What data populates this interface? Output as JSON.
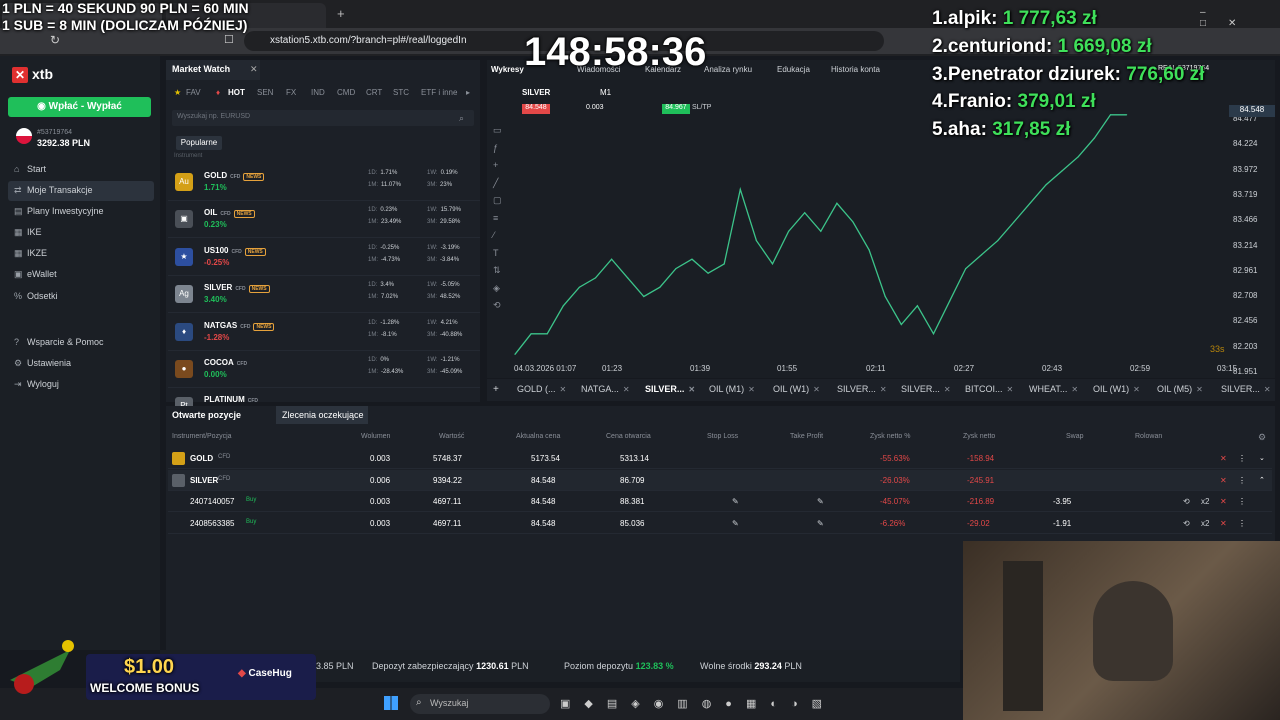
{
  "overlay": {
    "top_line1": "1 PLN =  40 SEKUND 90 PLN = 60 MIN",
    "top_line2": "1 SUB = 8 MIN (DOLICZAM PÓŹNIEJ)",
    "timer": "148:58:36",
    "leaderboard": [
      {
        "rank_name": "1.alpik:",
        "amount": "1 777,63 zł"
      },
      {
        "rank_name": "2.centuriond:",
        "amount": "1 669,08 zł"
      },
      {
        "rank_name": "3.Penetrator dziurek:",
        "amount": "776,60 zł"
      },
      {
        "rank_name": "4.Franio:",
        "amount": "379,01 zł"
      },
      {
        "rank_name": "5.aha:",
        "amount": "317,85 zł"
      }
    ],
    "bonus_amount": "$1.00",
    "bonus_text": "WELCOME BONUS",
    "bonus_brand": "CaseHug",
    "real_badge": "REAL 53719764"
  },
  "browser": {
    "url": "xstation5.xtb.com/?branch=pl#/real/loggedIn"
  },
  "sidebar": {
    "logo": "xtb",
    "deposit_button": "Wpłać - Wypłać",
    "account_number": "#53719764",
    "balance": "3292.38 PLN",
    "items": [
      {
        "label": "Start",
        "icon": "home-icon"
      },
      {
        "label": "Moje Transakcje",
        "icon": "transactions-icon"
      },
      {
        "label": "Plany Inwestycyjne",
        "icon": "plans-icon"
      },
      {
        "label": "IKE",
        "icon": "ike-icon"
      },
      {
        "label": "IKZE",
        "icon": "ikze-icon"
      },
      {
        "label": "eWallet",
        "icon": "wallet-icon"
      },
      {
        "label": "Odsetki",
        "icon": "percent-icon"
      },
      {
        "label": "Wsparcie & Pomoc",
        "icon": "help-icon"
      },
      {
        "label": "Ustawienia",
        "icon": "settings-icon"
      },
      {
        "label": "Wyloguj",
        "icon": "logout-icon"
      }
    ]
  },
  "market_watch": {
    "title": "Market Watch",
    "filters": [
      "FAV",
      "HOT",
      "SEN",
      "FX",
      "IND",
      "CMD",
      "CRT",
      "STC",
      "ETF i inne"
    ],
    "search_placeholder": "Wyszukaj np. EURUSD",
    "popular_button": "Popularne",
    "section_label": "Instrument",
    "cfd_label": "CFD",
    "news_label": "NEWS",
    "instruments": [
      {
        "name": "GOLD",
        "change": "1.71%",
        "icon": "Au",
        "color": "#d4a017",
        "d1": "1.71%",
        "m1": "11.07%",
        "w1": "0.19%",
        "m3": "23%",
        "news": true
      },
      {
        "name": "OIL",
        "change": "0.23%",
        "icon": "▣",
        "color": "#4a4f57",
        "d1": "0.23%",
        "m1": "23.49%",
        "w1": "15.79%",
        "m3": "29.58%",
        "news": true
      },
      {
        "name": "US100",
        "change": "-0.25%",
        "icon": "★",
        "color": "#2d4fa0",
        "d1": "-0.25%",
        "m1": "-4.73%",
        "w1": "-3.19%",
        "m3": "-3.84%",
        "news": true
      },
      {
        "name": "SILVER",
        "change": "3.40%",
        "icon": "Ag",
        "color": "#7d8590",
        "d1": "3.4%",
        "m1": "7.02%",
        "w1": "-5.05%",
        "m3": "48.52%",
        "news": true
      },
      {
        "name": "NATGAS",
        "change": "-1.28%",
        "icon": "♦",
        "color": "#2b4a80",
        "d1": "-1.28%",
        "m1": "-8.1%",
        "w1": "4.21%",
        "m3": "-40.88%",
        "news": true
      },
      {
        "name": "COCOA",
        "change": "0.00%",
        "icon": "●",
        "color": "#7a4a1e",
        "d1": "0%",
        "m1": "-28.43%",
        "w1": "-1.21%",
        "m3": "-45.09%",
        "news": false
      },
      {
        "name": "PLATINUM",
        "change": "",
        "icon": "Pt",
        "color": "#5a6068",
        "d1": "",
        "m1": "",
        "w1": "",
        "m3": "",
        "news": false
      }
    ],
    "stat_labels": {
      "d1": "1D:",
      "m1": "1M:",
      "w1": "1W:",
      "m3": "3M:"
    }
  },
  "chart_panel": {
    "menu": [
      "Wykresy",
      "Wiadomości",
      "Kalendarz",
      "Analiza rynku",
      "Edukacja",
      "Historia konta"
    ],
    "symbol": "SILVER",
    "timeframe": "M1",
    "bid": "84.548",
    "volume": "0.003",
    "ask": "84.967",
    "sltp": "SL/TP",
    "countdown": "33s",
    "y_ticks": [
      "84.477",
      "84.224",
      "83.972",
      "83.719",
      "83.466",
      "83.214",
      "82.961",
      "82.708",
      "82.456",
      "82.203",
      "81.951"
    ],
    "price_marker": "84.548",
    "x_ticks": [
      "04.03.2026 01:07",
      "01:23",
      "01:39",
      "01:55",
      "02:11",
      "02:27",
      "02:43",
      "02:59",
      "03:15"
    ],
    "symbol_tabs": [
      "GOLD (...",
      "NATGA...",
      "SILVER...",
      "OIL (M1)",
      "OIL (W1)",
      "SILVER...",
      "SILVER...",
      "BITCOI...",
      "WHEAT...",
      "OIL (W1)",
      "OIL (M5)",
      "SILVER..."
    ],
    "active_tab_index": 2
  },
  "chart_data": {
    "type": "line",
    "x": [
      "01:07",
      "01:10",
      "01:13",
      "01:16",
      "01:19",
      "01:22",
      "01:25",
      "01:28",
      "01:31",
      "01:34",
      "01:37",
      "01:40",
      "01:43",
      "01:46",
      "01:49",
      "01:52",
      "01:55",
      "01:58",
      "02:01",
      "02:04",
      "02:07",
      "02:10",
      "02:13",
      "02:16",
      "02:19",
      "02:22",
      "02:25",
      "02:28",
      "02:31",
      "02:34",
      "02:37",
      "02:40",
      "02:43",
      "02:46",
      "02:49",
      "02:52",
      "02:55",
      "02:58",
      "03:01"
    ],
    "values": [
      81.98,
      82.2,
      82.2,
      82.5,
      82.7,
      82.8,
      83.0,
      82.8,
      82.6,
      82.7,
      82.9,
      83.0,
      82.85,
      82.95,
      83.75,
      83.2,
      82.95,
      83.3,
      83.5,
      83.3,
      83.6,
      83.4,
      83.1,
      82.6,
      82.3,
      82.5,
      82.2,
      82.55,
      82.9,
      83.05,
      83.2,
      83.4,
      83.6,
      83.8,
      83.95,
      84.1,
      84.3,
      84.55,
      84.55
    ],
    "ylim": [
      81.951,
      84.548
    ]
  },
  "positions": {
    "tab_open": "Otwarte pozycje",
    "tab_pending": "Zlecenia oczekujące",
    "headers": [
      "Instrument/Pozycja",
      "Wolumen",
      "Wartość",
      "Aktualna cena",
      "Cena otwarcia",
      "Stop Loss",
      "Take Profit",
      "Zysk netto %",
      "Zysk netto",
      "Swap",
      "Rolowan"
    ],
    "rows": [
      {
        "instrument": "GOLD",
        "volume": "0.003",
        "value": "5748.37",
        "current": "5173.54",
        "open": "5313.14",
        "pct": "-55.63%",
        "net": "-158.94",
        "swap": ""
      },
      {
        "instrument": "SILVER",
        "volume": "0.006",
        "value": "9394.22",
        "current": "84.548",
        "open": "86.709",
        "pct": "-26.03%",
        "net": "-245.91",
        "swap": ""
      },
      {
        "instrument": "2407140057",
        "side": "Buy",
        "volume": "0.003",
        "value": "4697.11",
        "current": "84.548",
        "open": "88.381",
        "pct": "-45.07%",
        "net": "-216.89",
        "swap": "-3.95"
      },
      {
        "instrument": "2408563385",
        "side": "Buy",
        "volume": "0.003",
        "value": "4697.11",
        "current": "84.548",
        "open": "85.036",
        "pct": "-6.26%",
        "net": "-29.02",
        "swap": "-1.91"
      }
    ]
  },
  "footer": {
    "balance_tail": "3.85",
    "currency": "PLN",
    "margin_label": "Depozyt zabezpieczający",
    "margin_value": "1230.61",
    "level_label": "Poziom depozytu",
    "level_value": "123.83 %",
    "free_label": "Wolne środki",
    "free_value": "293.24"
  },
  "taskbar": {
    "search_placeholder": "Wyszukaj"
  }
}
